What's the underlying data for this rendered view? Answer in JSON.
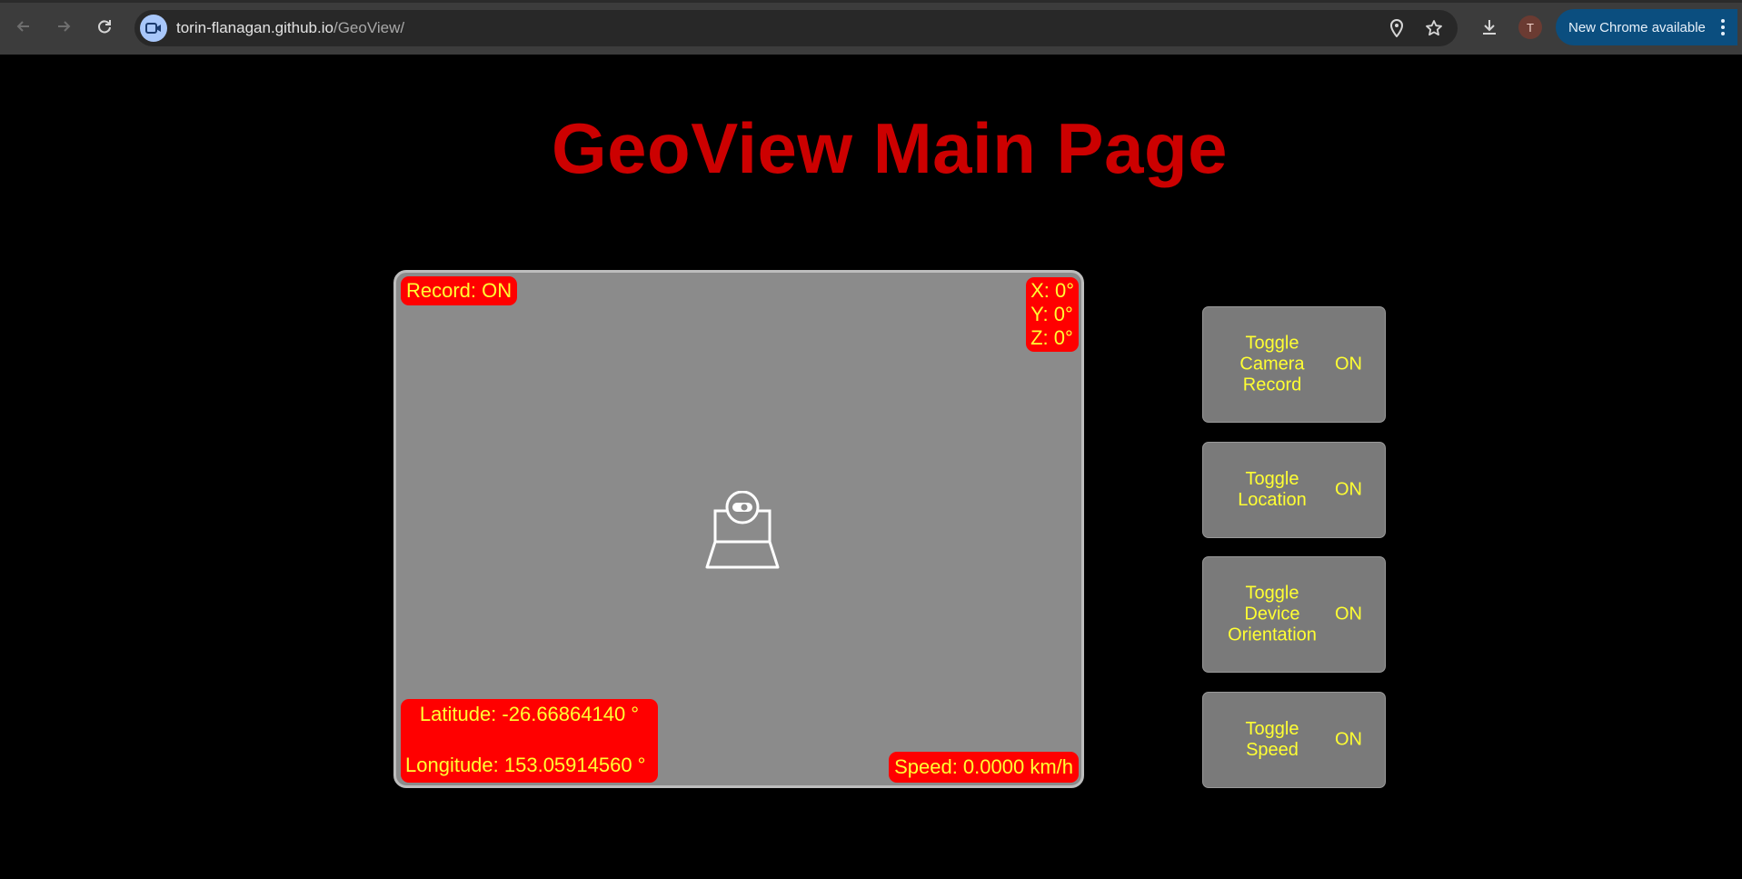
{
  "browser": {
    "url_host": "torin-flanagan.github.io",
    "url_path": "/GeoView/",
    "profile_initial": "T",
    "update_label": "New Chrome available",
    "icons": [
      "back-icon",
      "forward-icon",
      "reload-icon",
      "site-camera-icon",
      "location-icon",
      "bookmark-star-icon",
      "download-icon",
      "more-icon"
    ]
  },
  "page": {
    "title": "GeoView Main Page"
  },
  "viewer": {
    "record_status": "Record: ON",
    "orientation": {
      "x": "X: 0°",
      "y": "Y: 0°",
      "z": "Z: 0°"
    },
    "latitude": "Latitude: -26.66864140 °",
    "longitude": "Longitude: 153.05914560 °",
    "speed": "Speed: 0.0000 km/h",
    "center_icon": "webcam-icon"
  },
  "toggles": [
    {
      "label_lines": [
        "Toggle",
        "Camera",
        "Record"
      ],
      "state": "ON"
    },
    {
      "label_lines": [
        "Toggle",
        "Location"
      ],
      "state": "ON"
    },
    {
      "label_lines": [
        "Toggle",
        "Device",
        "Orientation"
      ],
      "state": "ON"
    },
    {
      "label_lines": [
        "Toggle",
        "Speed"
      ],
      "state": "ON"
    }
  ],
  "colors": {
    "title": "#cc0000",
    "tag_bg": "#ff0000",
    "tag_text": "#ffff33",
    "viewer_bg": "#8b8b8b",
    "button_bg": "#7a7a7a",
    "page_bg": "#000000"
  }
}
